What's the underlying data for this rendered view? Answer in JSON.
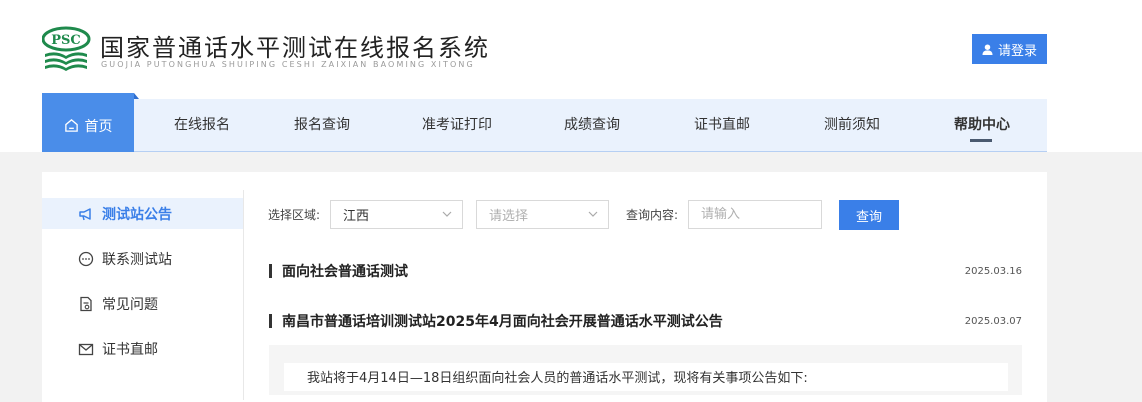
{
  "header": {
    "logo_text": "PSC",
    "title": "国家普通话水平测试在线报名系统",
    "subtitle": "GUOJIA PUTONGHUA SHUIPING CESHI ZAIXIAN BAOMING XITONG",
    "login_label": "请登录"
  },
  "nav": {
    "home": "首页",
    "items": [
      "在线报名",
      "报名查询",
      "准考证打印",
      "成绩查询",
      "证书直邮",
      "测前须知",
      "帮助中心"
    ]
  },
  "sidebar": {
    "items": [
      {
        "label": "测试站公告",
        "icon": "megaphone-icon",
        "active": true
      },
      {
        "label": "联系测试站",
        "icon": "chat-icon"
      },
      {
        "label": "常见问题",
        "icon": "document-icon"
      },
      {
        "label": "证书直邮",
        "icon": "mail-icon"
      }
    ]
  },
  "filters": {
    "region_label": "选择区域:",
    "region_value": "江西",
    "sub_region_placeholder": "请选择",
    "query_label": "查询内容:",
    "query_placeholder": "请输入",
    "query_button": "查询"
  },
  "notices": [
    {
      "title": "面向社会普通话测试",
      "date": "2025.03.16"
    },
    {
      "title": "南昌市普通话培训测试站2025年4月面向社会开展普通话水平测试公告",
      "date": "2025.03.07"
    }
  ],
  "excerpt": "我站将于4月14日—18日组织面向社会人员的普通话水平测试，现将有关事项公告如下:",
  "colors": {
    "accent": "#3a7fe8",
    "nav_bg": "#eaf2fd",
    "logo_green": "#1f8a4c"
  }
}
